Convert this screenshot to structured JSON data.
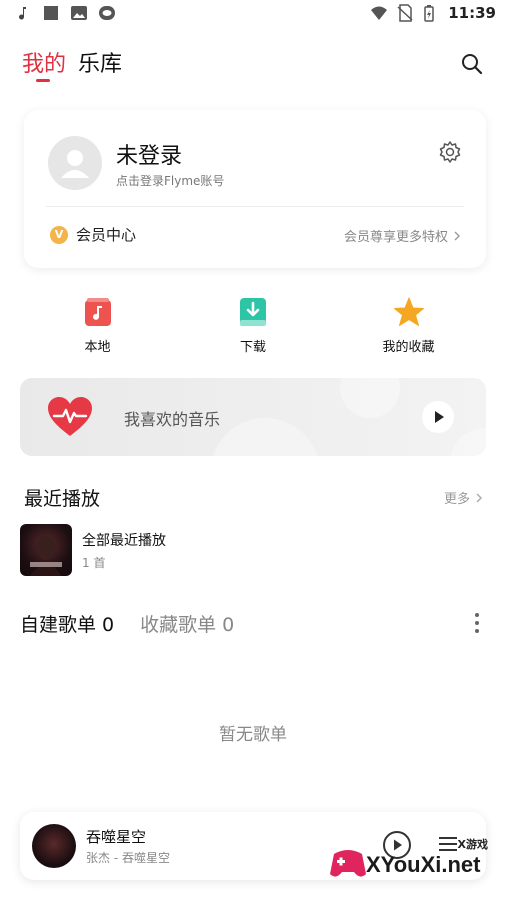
{
  "status_bar": {
    "time": "11:39",
    "left_icons": [
      "music-note-icon",
      "square-icon",
      "image-icon",
      "cloud-icon"
    ],
    "right_icons": [
      "wifi-icon",
      "no-sim-icon",
      "battery-icon"
    ]
  },
  "header": {
    "tabs": [
      {
        "label": "我的",
        "active": true
      },
      {
        "label": "乐库",
        "active": false
      }
    ],
    "search_icon": "search-icon"
  },
  "account_card": {
    "title": "未登录",
    "subtitle": "点击登录Flyme账号",
    "vip_badge": "V",
    "vip_label": "会员中心",
    "vip_link": "会员尊享更多特权"
  },
  "quick_entries": [
    {
      "label": "本地",
      "icon": "local-music-icon",
      "color": "#ef5350"
    },
    {
      "label": "下载",
      "icon": "download-icon",
      "color": "#2ec4a6"
    },
    {
      "label": "我的收藏",
      "icon": "star-icon",
      "color": "#f5a623"
    }
  ],
  "favorites": {
    "label": "我喜欢的音乐"
  },
  "recent": {
    "title": "最近播放",
    "more": "更多",
    "item_name": "全部最近播放",
    "item_count": "1 首"
  },
  "playlists": {
    "tabs": [
      "自建歌单 0",
      "收藏歌单 0"
    ],
    "empty_text": "暂无歌单"
  },
  "mini_player": {
    "title": "吞噬星空",
    "subtitle": "张杰 - 吞噬星空"
  },
  "watermark": {
    "text": "XYouXi.net",
    "small": "X游戏"
  },
  "colors": {
    "accent": "#e1303f",
    "vip": "#f3b44b"
  }
}
